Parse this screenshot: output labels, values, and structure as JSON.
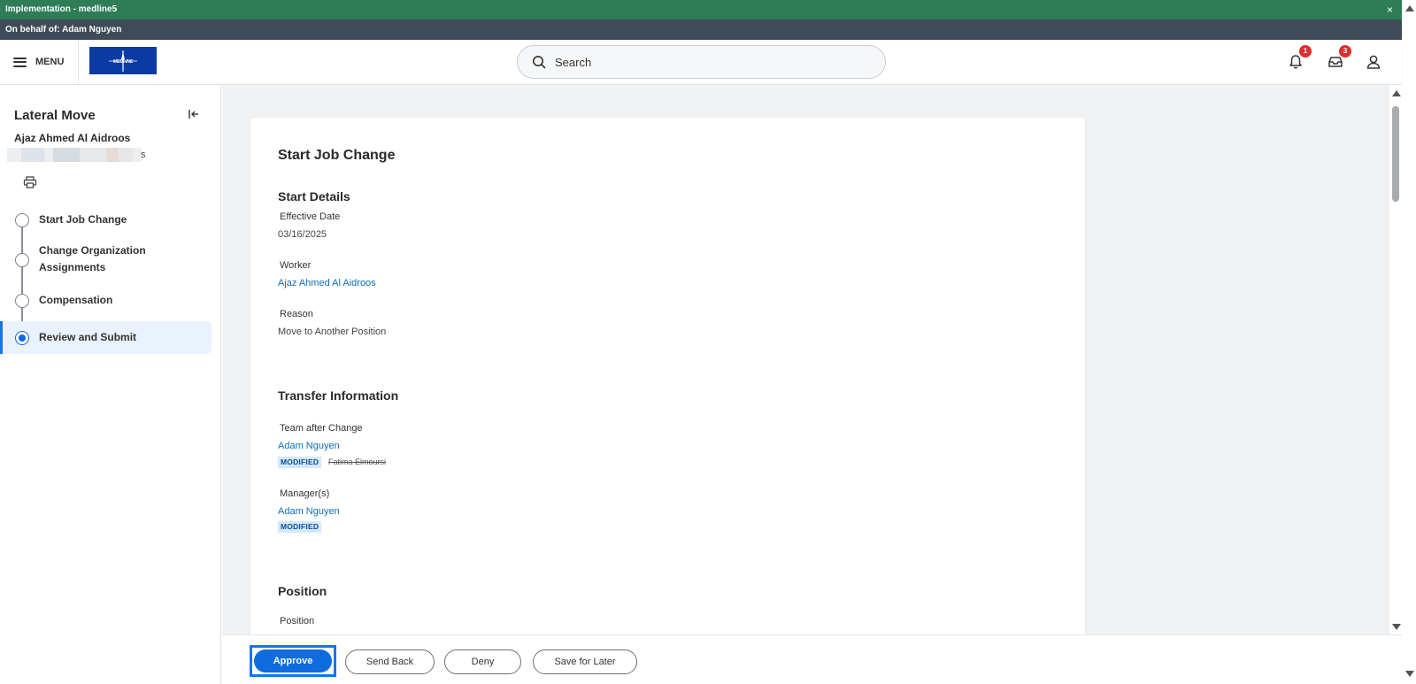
{
  "env_bar": {
    "title": "Implementation - medline5",
    "close": "×"
  },
  "proxy_bar": {
    "text": "On behalf of: Adam Nguyen"
  },
  "header": {
    "menu_label": "MENU",
    "logo_text": "MEDLINE",
    "search_placeholder": "Search",
    "notifications_count": "1",
    "inbox_count": "3"
  },
  "left_panel": {
    "title": "Lateral Move",
    "worker_name": "Ajaz Ahmed Al Aidroos",
    "position_suffix": "s",
    "steps": [
      {
        "label": "Start Job Change",
        "active": false
      },
      {
        "label": "Change Organization Assignments",
        "active": false
      },
      {
        "label": "Compensation",
        "active": false
      },
      {
        "label": "Review and Submit",
        "active": true
      }
    ]
  },
  "main": {
    "page_title": "Start Job Change",
    "start_details": {
      "heading": "Start Details",
      "effective_date_label": "Effective Date",
      "effective_date_value": "03/16/2025",
      "worker_label": "Worker",
      "worker_value": "Ajaz Ahmed Al Aidroos",
      "reason_label": "Reason",
      "reason_value": "Move to Another Position"
    },
    "transfer": {
      "heading": "Transfer Information",
      "team_label": "Team after Change",
      "team_value": "Adam Nguyen",
      "team_modified": "MODIFIED",
      "team_previous": "Fatima Elmoursi",
      "manager_label": "Manager(s)",
      "manager_value": "Adam Nguyen",
      "manager_modified": "MODIFIED"
    },
    "position": {
      "heading": "Position",
      "position_label": "Position"
    }
  },
  "footer": {
    "approve": "Approve",
    "send_back": "Send Back",
    "deny": "Deny",
    "save_for_later": "Save for Later"
  },
  "colors": {
    "env_green": "#2e7d57",
    "proxy_gray": "#3f4b58",
    "primary_blue": "#0f6cde",
    "link_blue": "#0f6cbd",
    "badge_red": "#de2f2f",
    "logo_blue": "#0c3aa3"
  }
}
